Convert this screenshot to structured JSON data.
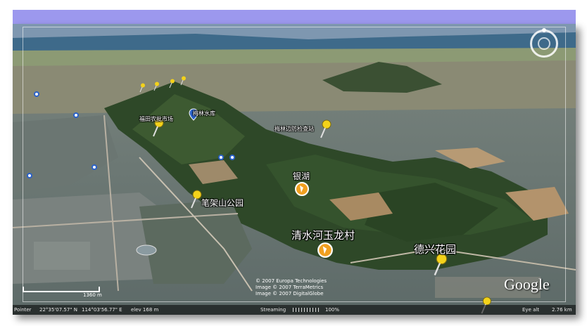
{
  "labels": {
    "meilin_reservoir": "梅林水库",
    "huangtian_market": "福田农批市场",
    "meilin_checkpoint": "梅林边防检查站",
    "yinhu": "银湖",
    "bijiashan_park": "笔架山公园",
    "qingshuihe": "清水河玉龙村",
    "dexing_garden": "德兴花园"
  },
  "scale": {
    "label": "1360 m"
  },
  "attribution": [
    "© 2007 Europa Technologies",
    "Image © 2007 TerraMetrics",
    "Image © 2007 DigitalGlobe"
  ],
  "logo": "Google",
  "status": {
    "pointer": "Pointer",
    "lat": "22°35'07.57\" N",
    "lon": "114°03'56.77\" E",
    "elev": "elev  168 m",
    "streaming": "Streaming",
    "percent": "100%",
    "eye_alt_label": "Eye alt",
    "eye_alt_value": "2.76 km"
  },
  "colors": {
    "accent_bar": "#9c98ee",
    "pin_yellow": "#f3d21a",
    "poi_orange": "#f0a020",
    "marker_blue": "#2b62c9"
  },
  "icons": {
    "pin": "yellow-pushpin-icon",
    "poi": "orange-poi-icon",
    "nav": "navigation-compass-icon"
  }
}
